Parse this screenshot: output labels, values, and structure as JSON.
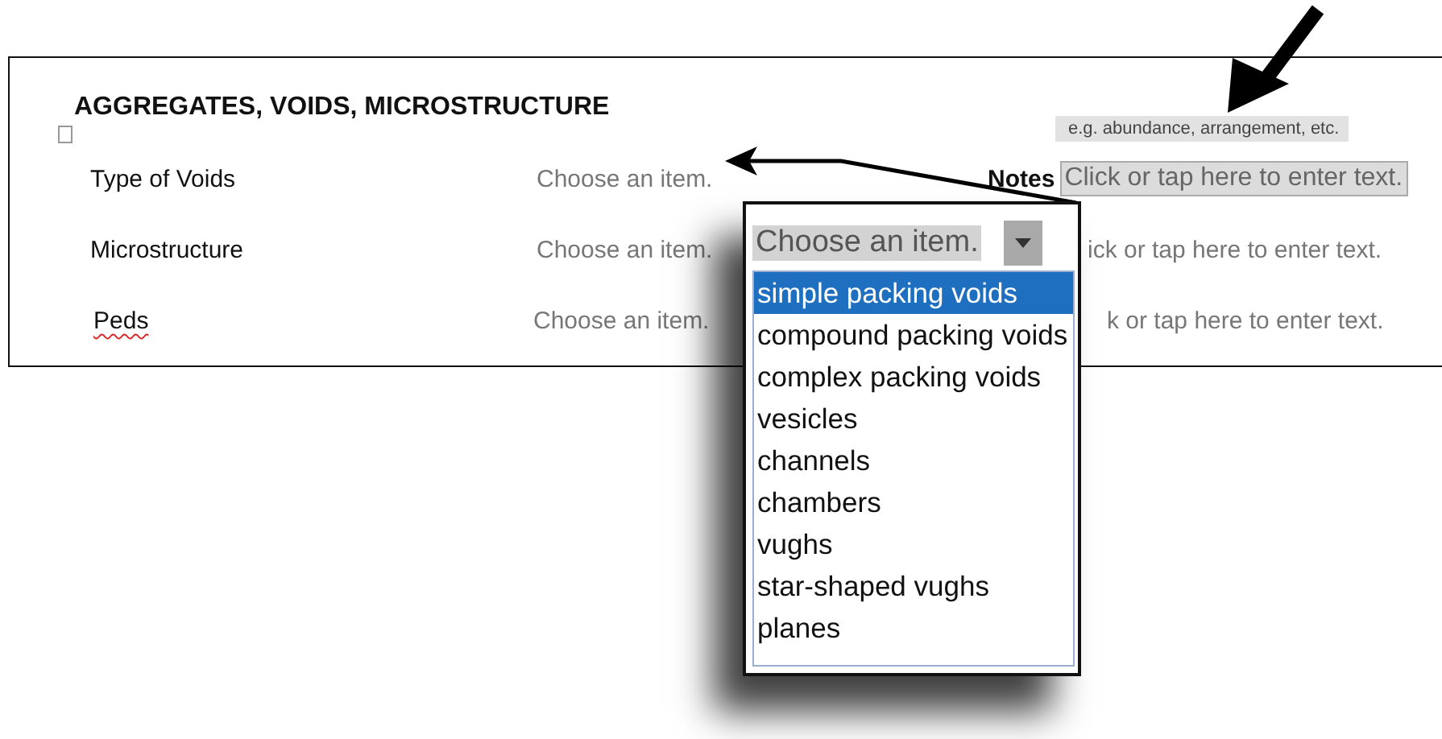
{
  "section": {
    "title": "AGGREGATES, VOIDS, MICROSTRUCTURE"
  },
  "rows": [
    {
      "label": "Type of Voids",
      "misspelled": false,
      "value": "Choose an item.",
      "notes_label": "Notes",
      "notes": "Click or tap here to enter text.",
      "notes_hint": "e.g. abundance, arrangement, etc.",
      "kind": "focused"
    },
    {
      "label": "Microstructure",
      "misspelled": false,
      "value": "Choose an item.",
      "notes": "ick or tap here to enter text.",
      "kind": "partial"
    },
    {
      "label": "Peds",
      "misspelled": true,
      "value": "Choose an item.",
      "notes": "k or tap here to enter text.",
      "kind": "partial-more"
    }
  ],
  "callout": {
    "combo_value": "Choose an item.",
    "options": [
      {
        "label": "simple packing voids",
        "selected": true
      },
      {
        "label": "compound packing voids",
        "selected": false
      },
      {
        "label": "complex packing voids",
        "selected": false
      },
      {
        "label": "vesicles",
        "selected": false
      },
      {
        "label": "channels",
        "selected": false
      },
      {
        "label": "chambers",
        "selected": false
      },
      {
        "label": "vughs",
        "selected": false
      },
      {
        "label": "star-shaped vughs",
        "selected": false
      },
      {
        "label": "planes",
        "selected": false
      }
    ]
  }
}
